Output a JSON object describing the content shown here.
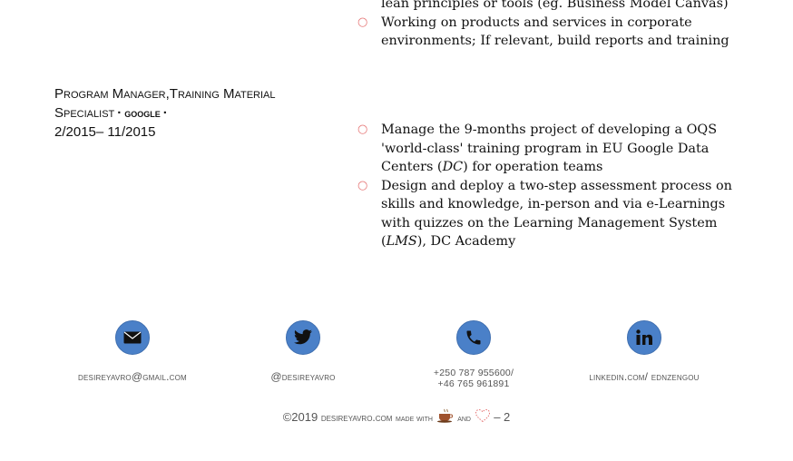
{
  "job": {
    "title_line1": "Program Manager,Training Material",
    "title_line2": "Specialist",
    "company": "google",
    "dates": "2/2015– 11/2015"
  },
  "top_bullets": [
    {
      "marker": "",
      "text": "lean principles or tools (eg. Business Model Canvas)"
    },
    {
      "marker": "○",
      "text": "Working on products and services in corporate environments; If relevant, build reports and training"
    }
  ],
  "job_bullets": [
    {
      "marker": "○",
      "before": "Manage the 9-months project of developing a OQS 'world-class' training program in EU Google Data Centers (",
      "em": "DC",
      "after": ") for operation teams"
    },
    {
      "marker": "○",
      "before": "Design and deploy a two-step assessment process on skills and knowledge, in-person and via e-Learnings with quizzes on the Learning Management System (",
      "em": "LMS",
      "after": "), DC Academy"
    }
  ],
  "contacts": {
    "email": {
      "icon": "envelope-icon",
      "label": "desireyavro@gmail.com"
    },
    "twitter": {
      "icon": "twitter-icon",
      "label": "@desireyavro"
    },
    "phone": {
      "icon": "phone-icon",
      "line1": "+250 787 955600/",
      "line2": "+46 765 961891"
    },
    "linkedin": {
      "icon": "linkedin-icon",
      "label": "linkedin.com/ ednzengou"
    }
  },
  "footer": {
    "copyright": "©2019",
    "site": "desireyavro.com",
    "made_with": "made with",
    "and": "and",
    "page": "– 2"
  },
  "colors": {
    "icon_circle": "#4a80c8",
    "bullet_marker": "#e57373"
  }
}
